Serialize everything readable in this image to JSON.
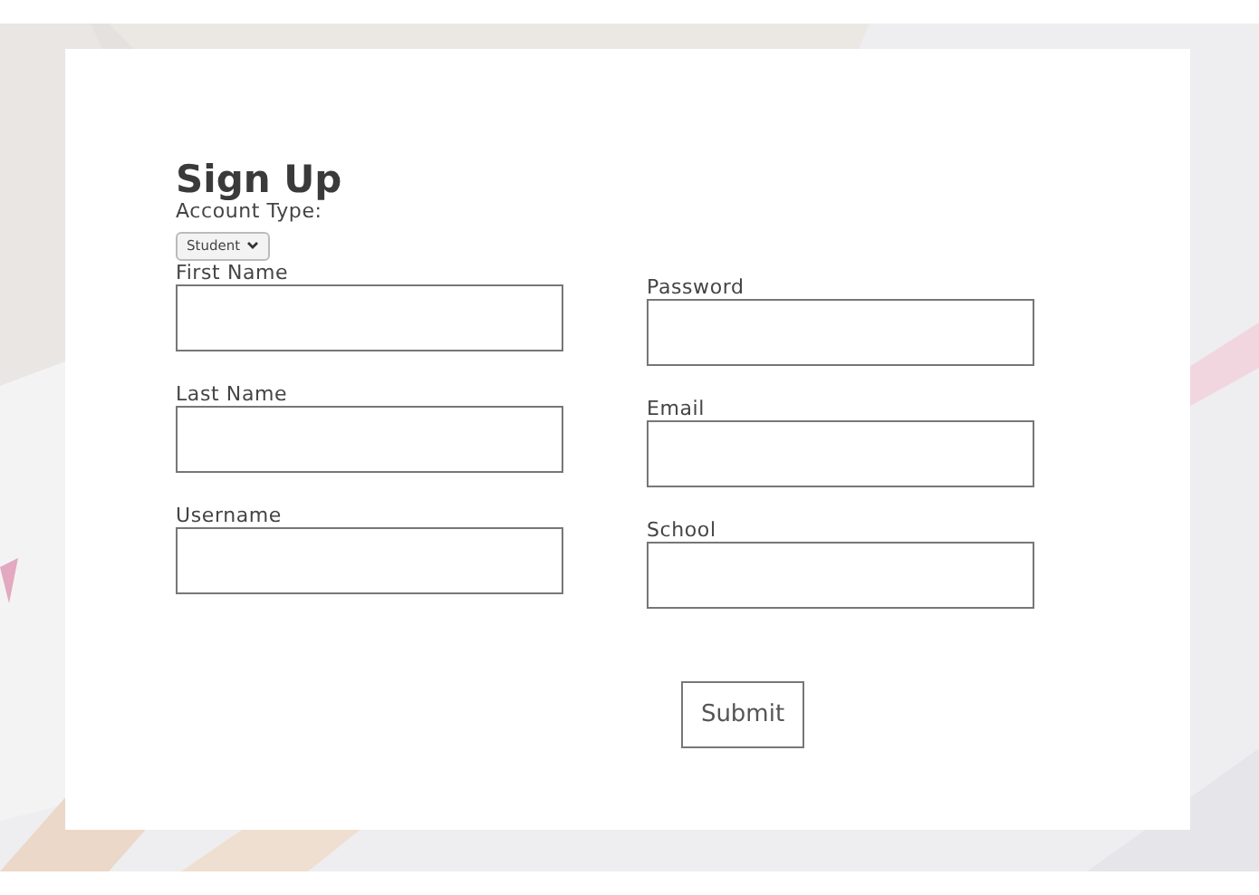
{
  "form": {
    "title": "Sign Up",
    "account_type_label": "Account Type:",
    "account_type_value": "Student",
    "left_fields": [
      {
        "label": "First Name"
      },
      {
        "label": "Last Name"
      },
      {
        "label": "Username"
      }
    ],
    "right_fields": [
      {
        "label": "Password"
      },
      {
        "label": "Email"
      },
      {
        "label": "School"
      }
    ],
    "submit": "Submit"
  }
}
